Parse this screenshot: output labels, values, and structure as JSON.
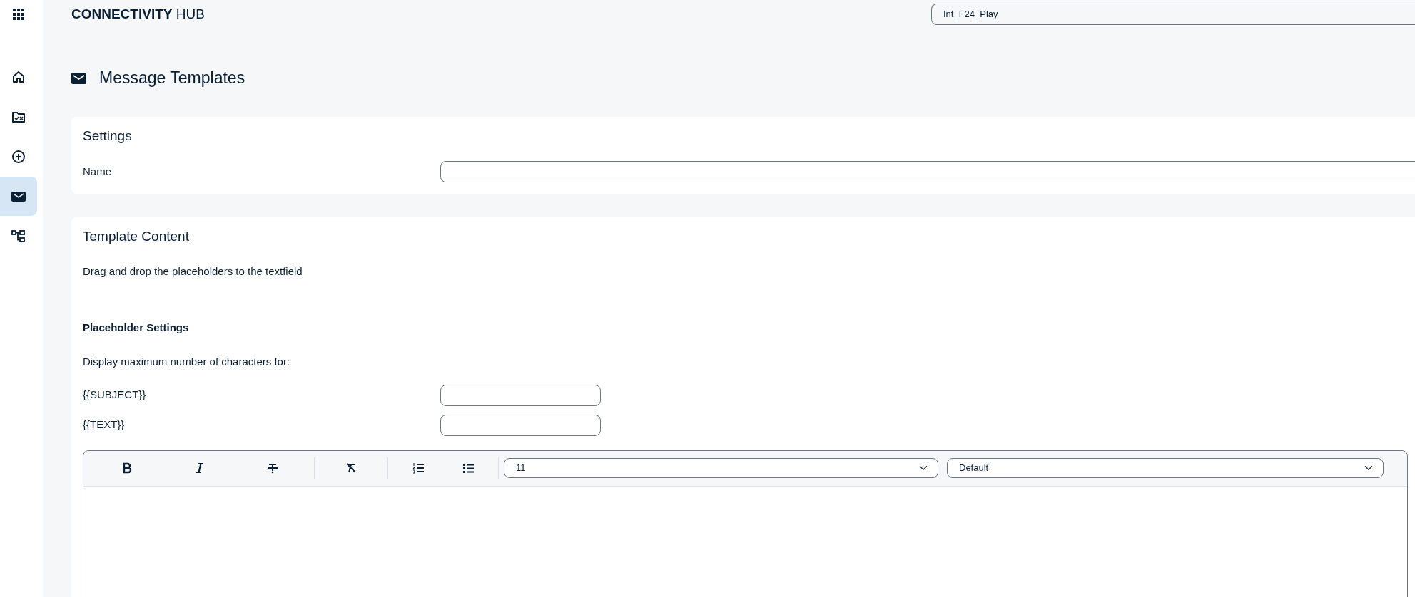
{
  "app": {
    "title_bold": "CONNECTIVITY",
    "title_rest": "HUB"
  },
  "sidebar": {
    "items": [
      {
        "kind": "home",
        "selected": false
      },
      {
        "kind": "folder",
        "selected": false
      },
      {
        "kind": "add",
        "selected": false
      },
      {
        "kind": "mail",
        "selected": true
      },
      {
        "kind": "tree",
        "selected": false
      }
    ]
  },
  "environment_select": {
    "value": "Int_F24_Play"
  },
  "page": {
    "title": "Message Templates"
  },
  "settings": {
    "title": "Settings",
    "fields": [
      {
        "label": "Name"
      }
    ]
  },
  "template_content": {
    "title": "Template Content",
    "hint": "Drag and drop the placeholders to the textfield",
    "placeholder_settings": {
      "title": "Placeholder Settings",
      "description": "Display maximum number of characters for:",
      "fields": [
        {
          "label": "{{SUBJECT}}"
        },
        {
          "label": "{{TEXT}}"
        }
      ]
    },
    "editor": {
      "toolbar_groups": [
        [
          {
            "kind": "bold"
          },
          {
            "kind": "italic"
          },
          {
            "kind": "strike"
          }
        ],
        [
          {
            "kind": "clear"
          }
        ],
        [
          {
            "kind": "ordered"
          },
          {
            "kind": "bullet"
          }
        ]
      ],
      "font_size": "11",
      "font": "Default"
    }
  }
}
